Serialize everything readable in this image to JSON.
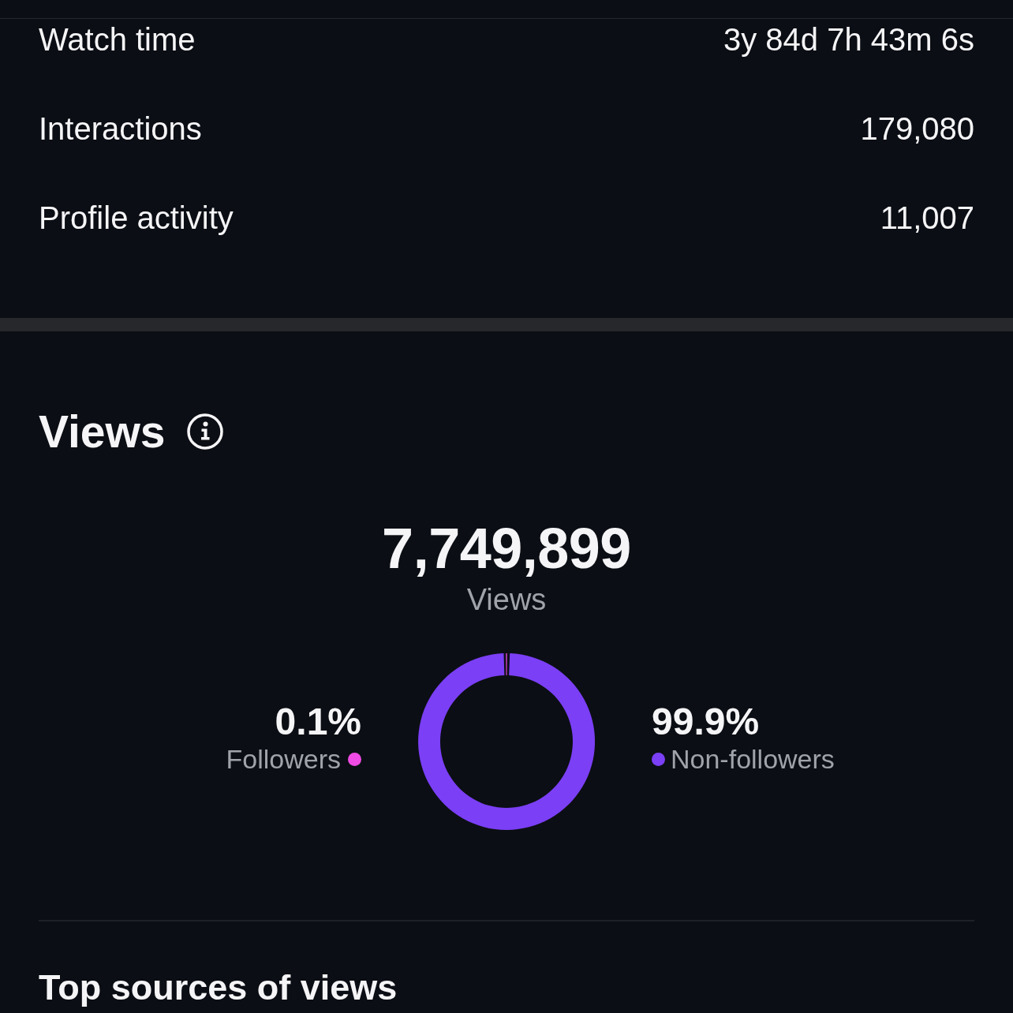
{
  "metrics": [
    {
      "label": "Watch time",
      "value": "3y 84d 7h 43m 6s"
    },
    {
      "label": "Interactions",
      "value": "179,080"
    },
    {
      "label": "Profile activity",
      "value": "11,007"
    }
  ],
  "views": {
    "title": "Views",
    "total": "7,749,899",
    "total_label": "Views",
    "legend": [
      {
        "percent": "0.1%",
        "color": "#f04be4"
      },
      {
        "percent": "99.9%",
        "color": "#7b3ff5"
      }
    ],
    "chart_data": {
      "type": "donut",
      "categories": [
        "Followers",
        "Non-followers"
      ],
      "values": [
        0.1,
        99.9
      ]
    }
  },
  "next_section": {
    "title": "Top sources of views"
  }
}
